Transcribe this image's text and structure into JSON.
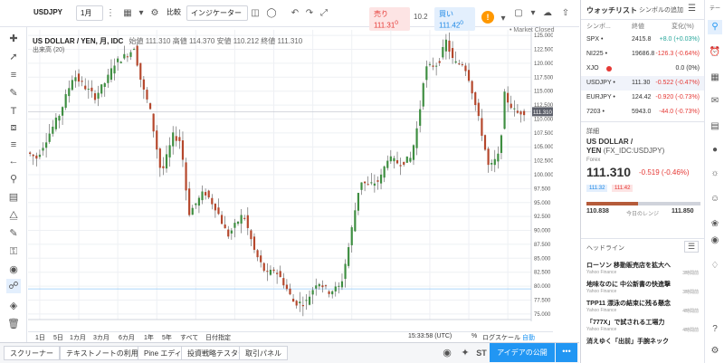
{
  "toolbar": {
    "symbol": "USDJPY",
    "interval": "1月",
    "compare": "比較",
    "indicators": "インジケーター",
    "sell_label": "売り",
    "sell_price": "111.31",
    "sell_sup": "0",
    "spread": "10.2",
    "buy_label": "買い",
    "buy_price": "111.42",
    "buy_sup": "0",
    "market_status": "• Market Closed"
  },
  "chart": {
    "title": "US DOLLAR / YEN, 月, IDC",
    "ohlc": "始値 111.310 高値 114.370 安値 110.212 終値 111.310",
    "volume": "出来高 (20)",
    "current_price": "111.310"
  },
  "chart_data": {
    "type": "candlestick",
    "x_ticks": [
      "2005",
      "2006",
      "2007",
      "2008",
      "2009",
      "2010",
      "2011",
      "2012",
      "2013",
      "2014",
      "2015",
      "2016",
      "2017"
    ],
    "y_ticks": [
      "125.000",
      "122.500",
      "120.000",
      "117.500",
      "115.000",
      "112.500",
      "110.000",
      "107.500",
      "105.000",
      "102.500",
      "100.000",
      "97.500",
      "95.000",
      "92.500",
      "90.000",
      "87.500",
      "85.000",
      "82.500",
      "80.000",
      "77.500",
      "75.000"
    ],
    "ylim": [
      74,
      126
    ],
    "xlim": [
      2004.7,
      2017.6
    ],
    "series": [
      {
        "name": "USDJPY",
        "anchors": [
          [
            2004.75,
            104
          ],
          [
            2005.0,
            103
          ],
          [
            2005.3,
            107
          ],
          [
            2005.6,
            111
          ],
          [
            2005.95,
            118
          ],
          [
            2006.2,
            116
          ],
          [
            2006.5,
            114
          ],
          [
            2006.8,
            117
          ],
          [
            2007.0,
            120
          ],
          [
            2007.4,
            122
          ],
          [
            2007.5,
            123
          ],
          [
            2007.7,
            116
          ],
          [
            2007.9,
            112
          ],
          [
            2008.2,
            100
          ],
          [
            2008.5,
            107
          ],
          [
            2008.7,
            106
          ],
          [
            2008.9,
            93
          ],
          [
            2009.1,
            95
          ],
          [
            2009.3,
            97
          ],
          [
            2009.6,
            94
          ],
          [
            2009.9,
            89
          ],
          [
            2010.3,
            93
          ],
          [
            2010.6,
            86
          ],
          [
            2010.9,
            82
          ],
          [
            2011.1,
            83
          ],
          [
            2011.3,
            81
          ],
          [
            2011.6,
            77
          ],
          [
            2011.9,
            77
          ],
          [
            2012.2,
            81
          ],
          [
            2012.5,
            79
          ],
          [
            2012.8,
            80
          ],
          [
            2013.0,
            87
          ],
          [
            2013.3,
            99
          ],
          [
            2013.5,
            98
          ],
          [
            2013.8,
            99
          ],
          [
            2014.0,
            103
          ],
          [
            2014.3,
            102
          ],
          [
            2014.6,
            103
          ],
          [
            2014.8,
            110
          ],
          [
            2014.95,
            119
          ],
          [
            2015.3,
            120
          ],
          [
            2015.5,
            124
          ],
          [
            2015.7,
            120
          ],
          [
            2015.95,
            120
          ],
          [
            2016.1,
            117
          ],
          [
            2016.4,
            108
          ],
          [
            2016.6,
            101
          ],
          [
            2016.9,
            104
          ],
          [
            2016.95,
            115
          ],
          [
            2017.1,
            113
          ],
          [
            2017.3,
            111
          ],
          [
            2017.45,
            111.3
          ]
        ]
      }
    ]
  },
  "bottom_timeframes": [
    "1日",
    "5日",
    "1カ月",
    "3カ月",
    "6カ月",
    "1年",
    "5年",
    "すべて",
    "日付指定"
  ],
  "bottom_right": {
    "time": "15:33:58 (UTC)",
    "percent": "%",
    "log": "ログスケール",
    "auto": "自動"
  },
  "bottom_tabs": [
    "スクリーナー",
    "テキストノートの利用",
    "Pine エディタ",
    "投資戦略テスター",
    "取引パネル"
  ],
  "bottom_icons": [
    "camera-icon",
    "twitter-icon",
    "stocktwits-icon"
  ],
  "stocktwits_label": "ST",
  "idea_button": "アイデアの公開",
  "watchlist": {
    "title": "ウォッチリスト",
    "add_symbol": "シンボルの追加",
    "columns": [
      "シンボ...",
      "終値",
      "変化(%)"
    ],
    "rows": [
      {
        "symbol": "SPX •",
        "last": "2415.8",
        "change": "+8.0 (+0.03%)",
        "dir": "pos"
      },
      {
        "symbol": "NI225 •",
        "last": "19686.8",
        "change": "-126.3 (-0.64%)",
        "dir": "neg"
      },
      {
        "symbol": "XJO",
        "last": "",
        "change": "0.0 (0%)",
        "dir": "neutral"
      },
      {
        "symbol": "USDJPY •",
        "last": "111.30",
        "change": "-0.522 (-0.47%)",
        "dir": "neg"
      },
      {
        "symbol": "EURJPY •",
        "last": "124.42",
        "change": "-0.920 (-0.73%)",
        "dir": "neg"
      },
      {
        "symbol": "7203 •",
        "last": "5943.0",
        "change": "-44.0 (-0.73%)",
        "dir": "neg"
      }
    ]
  },
  "details": {
    "label": "詳細",
    "name_line1": "US DOLLAR /",
    "name_line2": "YEN",
    "code": "(FX_IDC:USDJPY)",
    "market": "Forex",
    "price": "111.310",
    "change": "-0.519 (-0.46%)",
    "bid": "111.32",
    "ask": "111.42",
    "range_low": "110.838",
    "range_label": "今日のレンジ",
    "range_high": "111.850"
  },
  "headlines": {
    "label": "ヘッドライン",
    "items": [
      {
        "title": "ローソン 移動販売店を拡大へ",
        "source": "Yahoo Finance",
        "time": "3時間前"
      },
      {
        "title": "地味なのに 中公新書の快進撃",
        "source": "Yahoo Finance",
        "time": "3時間前"
      },
      {
        "title": "TPP11 漂泳の結束に残る懸念",
        "source": "Yahoo Finance",
        "time": "4時間前"
      },
      {
        "title": "「777X」で試される工場力",
        "source": "Yahoo Finance",
        "time": "4時間前"
      },
      {
        "title": "消えゆく「出前」手腕ネック",
        "source": "",
        "time": ""
      }
    ]
  },
  "right_panel_header": "テール"
}
